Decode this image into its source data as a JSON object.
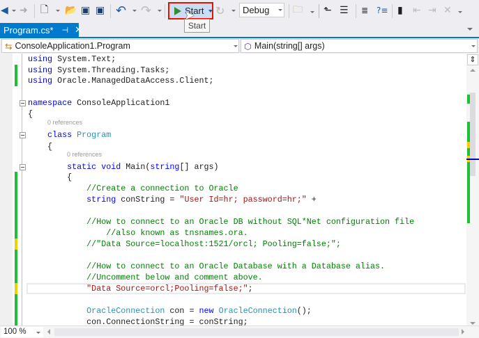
{
  "toolbar": {
    "start_label": "Start",
    "start_tooltip": "Start",
    "configuration": "Debug",
    "icons": [
      "back-icon",
      "forward-icon",
      "new-project-icon",
      "open-file-icon",
      "save-icon",
      "save-all-icon",
      "undo-icon",
      "redo-icon",
      "start-icon",
      "restart-icon",
      "find-in-files-icon",
      "step-icon",
      "outline-icon",
      "indent-icon",
      "comment-icon",
      "bookmark-icon",
      "prev-bookmark-icon",
      "next-bookmark-icon",
      "clear-bookmarks-icon"
    ]
  },
  "tab": {
    "label": "Program.cs*",
    "pin": "⊣",
    "close": "✕"
  },
  "nav": {
    "class_dropdown": "ConsoleApplication1.Program",
    "member_dropdown": "Main(string[] args)"
  },
  "editor": {
    "codelens": "0 references",
    "lines": [
      [
        [
          "using ",
          "kw"
        ],
        [
          "System.Text;",
          ""
        ]
      ],
      [
        [
          "using ",
          "kw"
        ],
        [
          "System.Threading.Tasks;",
          ""
        ]
      ],
      [
        [
          "using ",
          "kw"
        ],
        [
          "Oracle.ManagedDataAccess.Client;",
          ""
        ]
      ],
      [],
      [
        [
          "namespace ",
          "kw"
        ],
        [
          "ConsoleApplication1",
          ""
        ]
      ],
      [
        [
          "{",
          ""
        ]
      ],
      [
        [
          "    class ",
          "kw"
        ],
        [
          "Program",
          "ty"
        ]
      ],
      [
        [
          "    {",
          ""
        ]
      ],
      [
        [
          "        static void ",
          "kw"
        ],
        [
          "Main(",
          ""
        ],
        [
          "string",
          "kw"
        ],
        [
          "[] args)",
          ""
        ]
      ],
      [
        [
          "        {",
          ""
        ]
      ],
      [
        [
          "            //Create a connection to Oracle",
          "cm"
        ]
      ],
      [
        [
          "            string ",
          "kw"
        ],
        [
          "conString = ",
          ""
        ],
        [
          "\"User Id=hr; password=hr;\"",
          "st"
        ],
        [
          " +",
          ""
        ]
      ],
      [],
      [
        [
          "            //How to connect to an Oracle DB without SQL*Net configuration file",
          "cm"
        ]
      ],
      [
        [
          "                //also known as tnsnames.ora.",
          "cm"
        ]
      ],
      [
        [
          "            //\"Data Source=localhost:1521/orcl; Pooling=false;\";",
          "cm"
        ]
      ],
      [],
      [
        [
          "            //How to connect to an Oracle Database with a Database alias.",
          "cm"
        ]
      ],
      [
        [
          "            //Uncomment below and comment above.",
          "cm"
        ]
      ],
      [
        [
          "            \"Data Source=orcl;Pooling=false;\"",
          "st"
        ],
        [
          ";",
          ""
        ]
      ],
      [],
      [
        [
          "            OracleConnection ",
          "ty"
        ],
        [
          "con = ",
          ""
        ],
        [
          "new ",
          "kw"
        ],
        [
          "OracleConnection",
          "ty"
        ],
        [
          "();",
          ""
        ]
      ],
      [
        [
          "            con.ConnectionString = conString;",
          ""
        ]
      ]
    ]
  },
  "status": {
    "zoom": "100 %"
  },
  "colors": {
    "accent": "#007acc",
    "changed": "#1fbf3a",
    "unsaved": "#f5d000",
    "highlight_border": "#e51400"
  }
}
